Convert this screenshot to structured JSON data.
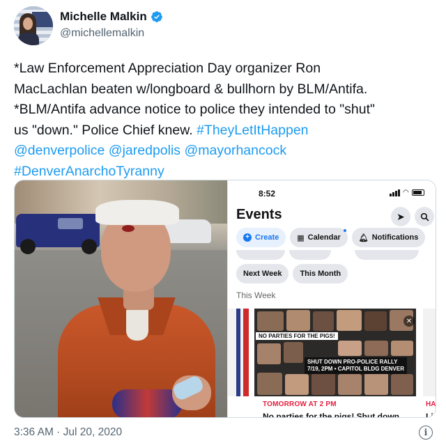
{
  "user": {
    "display_name": "Michelle Malkin",
    "handle": "@michellemalkin",
    "verified": true,
    "verified_color": "#1d9bf0"
  },
  "tweet": {
    "lines": [
      "*Law Enforcement Appreciation Day organizer Ron",
      "MacLachlan beaten w/longboard & bullhorn by BLM/Antifa.",
      "*BLM/Antifa advance notice to police they intended to \"shut\"",
      "us \"down.\" Police Chief knew. "
    ],
    "hashtag_1": "#TheyLetItHappen",
    "mentions": [
      "@denverpolice",
      "@jaredpolis",
      "@mayorhancock"
    ],
    "hashtag_2": "#DenverAnarchoTyranny",
    "link_color": "#1d9bf0"
  },
  "phone": {
    "time": "8:52",
    "title": "Events",
    "location_icon": "location-arrow-icon",
    "search_icon": "search-icon",
    "chips": [
      "Create",
      "Calendar",
      "Notifications"
    ],
    "chips_2": [
      "Next Week",
      "This Month"
    ],
    "section_label": "This Week",
    "card": {
      "banner_1": "NO PARTIES FOR THE PIGS!",
      "banner_2_line1": "SHUT DOWN PRO-POLICE RALLY",
      "banner_2_line2": "7/19, 2PM • CAPITOL BLDG DENVER",
      "when": "TOMORROW AT 2 PM",
      "title": "No parties for the pigs! Shut down",
      "when_cut": "HAP",
      "title_cut": "Li"
    }
  },
  "timestamp": "3:36 AM · Jul 20, 2020",
  "info_icon": "i"
}
